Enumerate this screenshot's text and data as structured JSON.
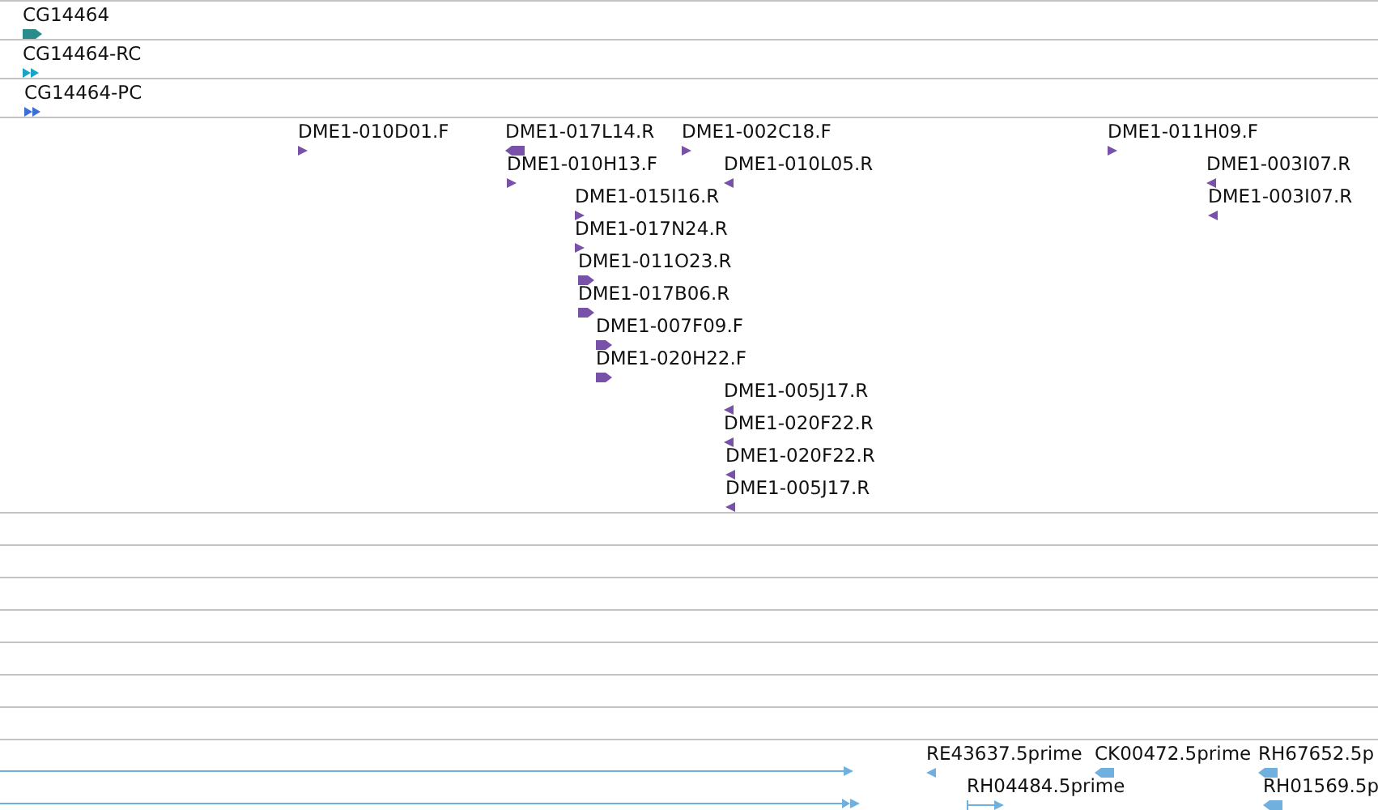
{
  "tracks": [
    {
      "kind": "features",
      "color": "#2b8c8c",
      "features": [
        {
          "label": "CG14464",
          "kind": "gene_right"
        }
      ]
    },
    {
      "kind": "features",
      "color": "#1ba3c6",
      "features": [
        {
          "label": "CG14464-RC",
          "kind": "double_right"
        }
      ]
    },
    {
      "kind": "features",
      "color": "#3b6fd6",
      "features": [
        {
          "label": "CG14464-PC",
          "kind": "double_right"
        }
      ]
    },
    {
      "kind": "features",
      "color": "#7851a9",
      "features": [
        {
          "label": "DME1-010D01.F",
          "kind": "right"
        },
        {
          "label": "DME1-017L14.R",
          "kind": "left_wide"
        },
        {
          "label": "DME1-002C18.F",
          "kind": "right"
        },
        {
          "label": "DME1-011H09.F",
          "kind": "right"
        },
        {
          "label": "DME1-010H13.F",
          "kind": "right"
        },
        {
          "label": "DME1-010L05.R",
          "kind": "left"
        },
        {
          "label": "DME1-003I07.R",
          "kind": "left"
        },
        {
          "label": "DME1-015I16.R",
          "kind": "right"
        },
        {
          "label": "DME1-003I07.R",
          "kind": "left"
        },
        {
          "label": "DME1-017N24.R",
          "kind": "right"
        },
        {
          "label": "DME1-011O23.R",
          "kind": "right_wide"
        },
        {
          "label": "DME1-017B06.R",
          "kind": "right_wide"
        },
        {
          "label": "DME1-007F09.F",
          "kind": "right_wide"
        },
        {
          "label": "DME1-020H22.F",
          "kind": "right_wide"
        },
        {
          "label": "DME1-005J17.R",
          "kind": "left"
        },
        {
          "label": "DME1-020F22.R",
          "kind": "left"
        },
        {
          "label": "DME1-020F22.R",
          "kind": "left"
        },
        {
          "label": "DME1-005J17.R",
          "kind": "left"
        }
      ]
    },
    {
      "kind": "empty"
    },
    {
      "kind": "empty"
    },
    {
      "kind": "empty"
    },
    {
      "kind": "empty"
    },
    {
      "kind": "empty"
    },
    {
      "kind": "empty"
    },
    {
      "kind": "empty"
    },
    {
      "kind": "features",
      "color": "#6fb0de",
      "features": [
        {
          "label": "RE43637.5prime",
          "kind": "left"
        },
        {
          "label": "CK00472.5prime",
          "kind": "left_wide"
        },
        {
          "label": "RH67652.5p",
          "kind": "left_wide"
        },
        {
          "label": "RH04484.5prime",
          "kind": "span"
        },
        {
          "label": "RH01569.5p",
          "kind": "left_wide"
        },
        {
          "kind": "line_right"
        },
        {
          "kind": "line_double"
        }
      ]
    }
  ]
}
